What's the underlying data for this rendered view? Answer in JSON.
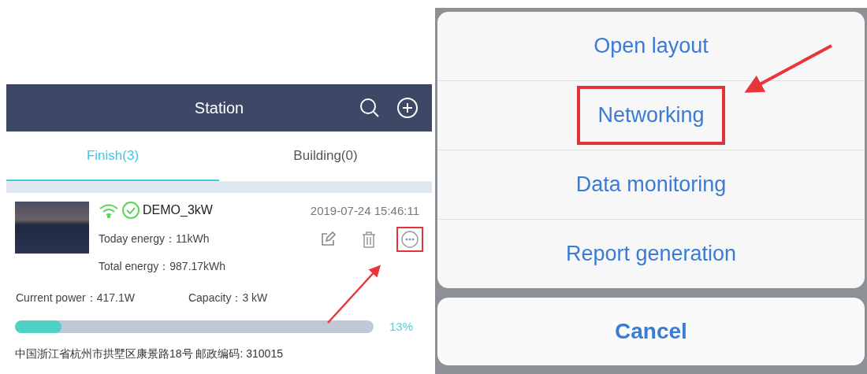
{
  "station_screen": {
    "title": "Station",
    "tabs": [
      {
        "label": "Finish(3)",
        "selected": true
      },
      {
        "label": "Building(0)",
        "selected": false
      }
    ],
    "station": {
      "name": "DEMO_3kW",
      "timestamp": "2019-07-24 15:46:11",
      "today_energy": "Today energy：11kWh",
      "total_energy": "Total energy：987.17kWh",
      "current_power": "Current power：417.1W",
      "capacity": "Capacity：3 kW",
      "level": 0.13,
      "percent": "13%",
      "address": "中国浙江省杭州市拱墅区康景路18号 邮政编码: 310015",
      "actions": [
        {
          "kind": "edit",
          "highlighted": false
        },
        {
          "kind": "delete",
          "highlighted": false
        },
        {
          "kind": "more",
          "highlighted": true
        }
      ]
    }
  },
  "action_sheet": {
    "items": [
      {
        "label": "Open layout",
        "highlighted": false
      },
      {
        "label": "Networking",
        "highlighted": true
      },
      {
        "label": "Data monitoring",
        "highlighted": false
      },
      {
        "label": "Report generation",
        "highlighted": false
      }
    ],
    "cancel": "Cancel"
  }
}
